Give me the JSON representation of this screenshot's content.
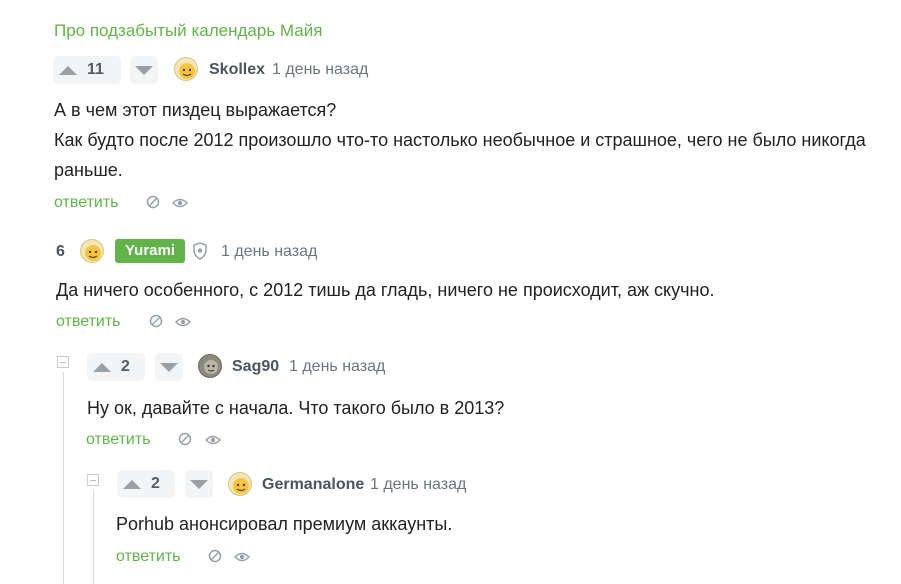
{
  "post_link": "Про подзабытый календарь Майя",
  "comments": [
    {
      "votes": "11",
      "username": "Skollex",
      "time": "1 день назад",
      "lines": [
        "А в чем этот пиздец выражается?",
        "Как будто после 2012 произошло что-то настолько необычное и страшное, чего не было никогда",
        "раньше."
      ],
      "reply_label": "ответить"
    },
    {
      "votes": "6",
      "username": "Yurami",
      "time": "1 день назад",
      "lines": [
        "Да ничего особенного, с 2012 тишь да гладь, ничего не происходит, аж скучно."
      ],
      "reply_label": "ответить"
    },
    {
      "votes": "2",
      "username": "Sag90",
      "time": "1 день назад",
      "lines": [
        "Ну ок, давайте с начала. Что такого было в 2013?"
      ],
      "reply_label": "ответить"
    },
    {
      "votes": "2",
      "username": "Germanalone",
      "time": "1 день назад",
      "lines": [
        "Porhub анонсировал премиум аккаунты."
      ],
      "reply_label": "ответить"
    }
  ],
  "icons": {
    "upvote": "arrow-up-icon",
    "downvote": "arrow-down-icon",
    "hide": "hide-icon",
    "views": "eye-icon",
    "shield": "shield-icon",
    "collapse": "collapse-icon"
  },
  "colors": {
    "accent_green": "#62b44a",
    "text": "#222222",
    "muted": "#6d757a"
  }
}
